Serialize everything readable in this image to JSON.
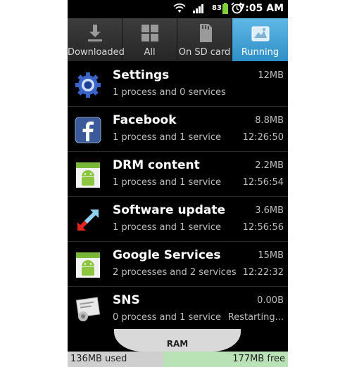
{
  "status_bar": {
    "battery_level": "83",
    "time": "7:05 AM",
    "icons": [
      "wifi-icon",
      "signal-icon",
      "battery-icon",
      "alarm-icon"
    ]
  },
  "tabs": [
    {
      "label": "Downloaded",
      "icon": "download-icon",
      "active": false
    },
    {
      "label": "All",
      "icon": "grid-icon",
      "active": false
    },
    {
      "label": "On SD card",
      "icon": "sd-card-icon",
      "active": false
    },
    {
      "label": "Running",
      "icon": "running-icon",
      "active": true
    }
  ],
  "processes": [
    {
      "name": "Settings",
      "detail": "1 process and 0 services",
      "size": "12MB",
      "time": "",
      "icon": "settings-gear-icon"
    },
    {
      "name": "Facebook",
      "detail": "1 process and 1 service",
      "size": "8.8MB",
      "time": "12:26:50",
      "icon": "facebook-icon"
    },
    {
      "name": "DRM content",
      "detail": "1 process and 1 service",
      "size": "2.2MB",
      "time": "12:56:54",
      "icon": "android-icon"
    },
    {
      "name": "Software update",
      "detail": "1 process and 1 service",
      "size": "3.6MB",
      "time": "12:56:56",
      "icon": "software-update-icon"
    },
    {
      "name": "Google Services",
      "detail": "2 processes and 2 services",
      "size": "15MB",
      "time": "12:22:32",
      "icon": "android-icon"
    },
    {
      "name": "SNS",
      "detail": "0 process and 1 service",
      "size": "0.00B",
      "time": "Restarting...",
      "icon": "sns-icon"
    }
  ],
  "ram": {
    "label": "RAM",
    "used": "136MB used",
    "free": "177MB free",
    "used_fraction": 0.435
  },
  "colors": {
    "active_tab": "#3ea3db",
    "ram_free": "#b9e2b6",
    "ram_used": "#cfcfcf"
  }
}
